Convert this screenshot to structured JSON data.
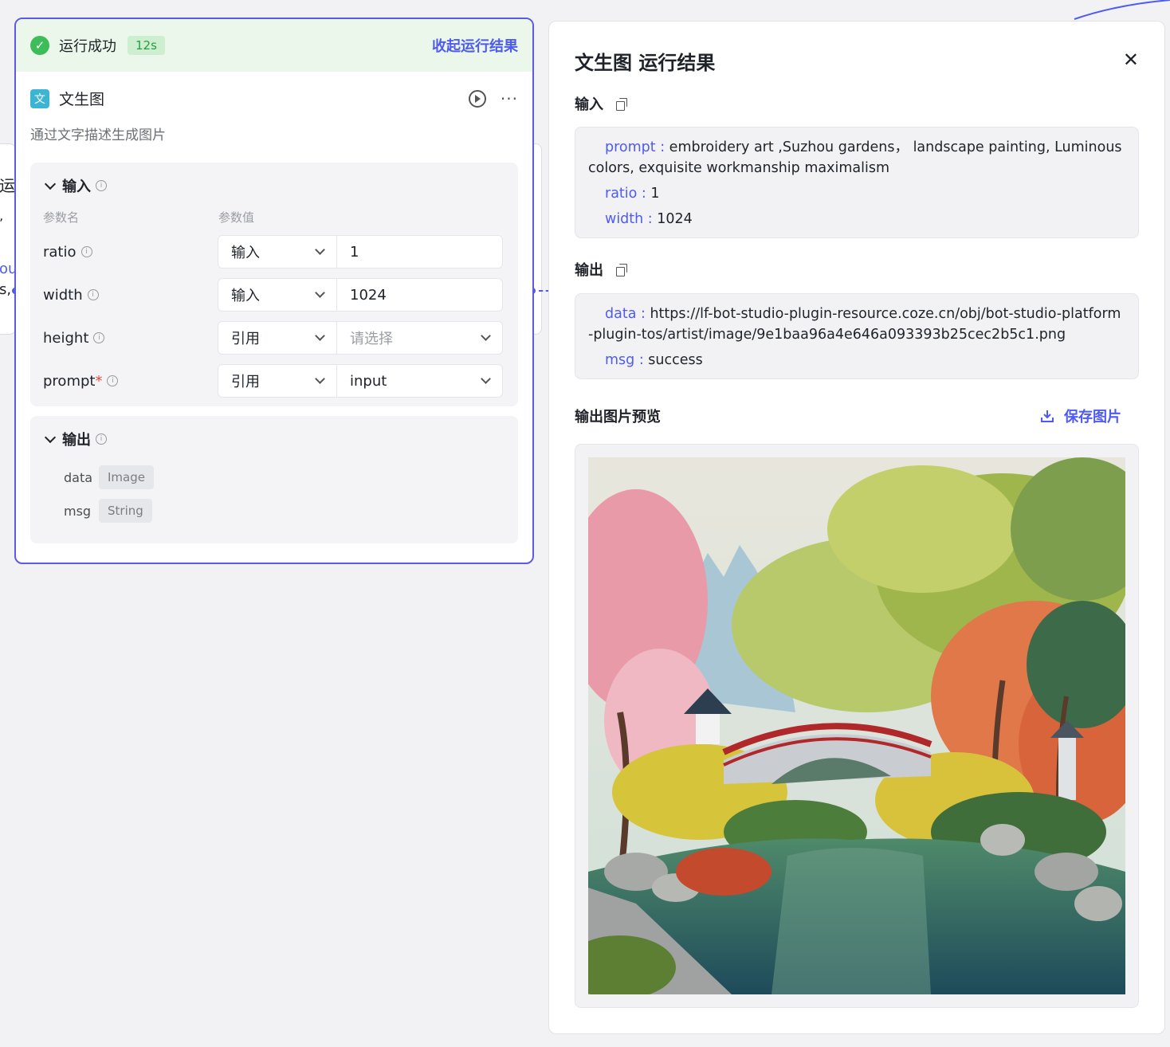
{
  "node": {
    "status": "运行成功",
    "duration": "12s",
    "collapse_label": "收起运行结果",
    "icon_char": "文",
    "title": "文生图",
    "description": "通过文字描述生成图片",
    "inputs_section": {
      "title": "输入",
      "col_name": "参数名",
      "col_value": "参数值",
      "params": [
        {
          "name": "ratio",
          "required": false,
          "mode": "输入",
          "value": "1",
          "placeholder": false
        },
        {
          "name": "width",
          "required": false,
          "mode": "输入",
          "value": "1024",
          "placeholder": false
        },
        {
          "name": "height",
          "required": false,
          "mode": "引用",
          "value": "请选择",
          "placeholder": true
        },
        {
          "name": "prompt",
          "required": true,
          "mode": "引用",
          "value": "input",
          "placeholder": false
        }
      ]
    },
    "outputs_section": {
      "title": "输出",
      "items": [
        {
          "name": "data",
          "type": "Image"
        },
        {
          "name": "msg",
          "type": "String"
        }
      ]
    }
  },
  "background": {
    "left_fragment_1": "运",
    "left_fragment_2": "ʼ",
    "left_fragment_3": "ou",
    "left_fragment_4": "s,"
  },
  "panel": {
    "title": "文生图 运行结果",
    "input_label": "输入",
    "input_lines": [
      {
        "key": "prompt :",
        "value": " embroidery art ,Suzhou gardens， landscape painting, Luminous colors, exquisite workmanship maximalism"
      },
      {
        "key": "ratio :",
        "value": " 1"
      },
      {
        "key": "width :",
        "value": " 1024"
      }
    ],
    "output_label": "输出",
    "output_lines": [
      {
        "key": "data :",
        "value": " https://lf-bot-studio-plugin-resource.coze.cn/obj/bot-studio-platform-plugin-tos/artist/image/9e1baa96a4e646a093393b25cec2b5c1.png"
      },
      {
        "key": "msg :",
        "value": " success"
      }
    ],
    "preview_label": "输出图片预览",
    "save_label": "保存图片"
  },
  "colors": {
    "accent": "#4e5bf2",
    "success": "#3dbd5a",
    "success_bg": "#eaf7ea"
  }
}
